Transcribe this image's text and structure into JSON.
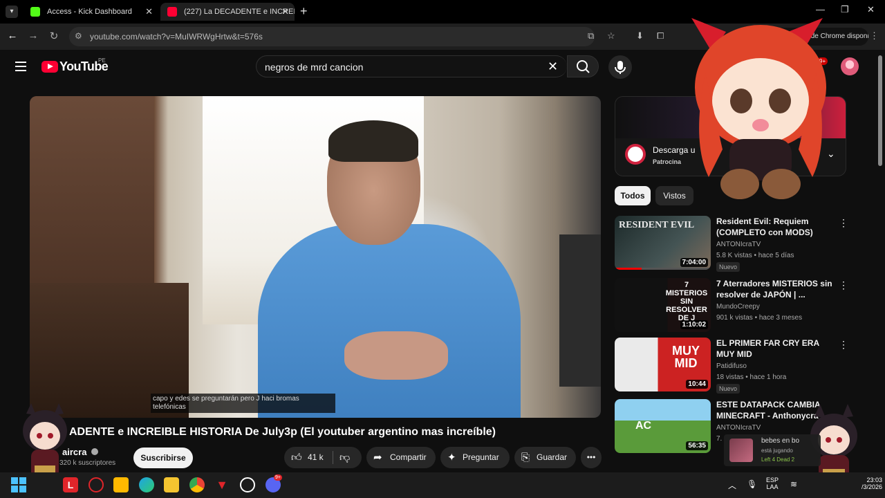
{
  "browser": {
    "tabs": [
      {
        "title": "Access - Kick Dashboard",
        "favicon": "kick-icon",
        "color": "#53fc18",
        "active": false
      },
      {
        "title": "(227) La DECADENTE e INCREIB",
        "favicon": "youtube-icon",
        "color": "#ff0033",
        "active": true
      }
    ],
    "url": "youtube.com/watch?v=MuIWRWgHrtw&t=576s",
    "update_text": "Nueva versión de Chrome disponible"
  },
  "header": {
    "logo_text": "YouTube",
    "country": "PE",
    "search_value": "negros de mrd cancion",
    "notifications": "9+"
  },
  "video": {
    "caption": "capo y edes se preguntarán pero J haci bromas telefónicas",
    "title": "ADENTE e INCREIBLE HISTORIA De July3p (El youtuber argentino mas increíble)",
    "channel": "aircra",
    "subscribers": "320 k suscriptores",
    "subscribe_label": "Suscribirse",
    "likes": "41 k",
    "share_label": "Compartir",
    "ask_label": "Preguntar",
    "save_label": "Guardar"
  },
  "ad": {
    "title": "Descarga u",
    "sponsor": "Patrocina"
  },
  "chips": [
    "Todos",
    "Vistos"
  ],
  "recommendations": [
    {
      "title": "Resident Evil: Requiem (COMPLETO con MODS)",
      "channel": "ANTONIcraTV",
      "meta": "5.8 K vistas • hace 5 días",
      "duration": "7:04:00",
      "badge": "Nuevo",
      "thumb_text": "RESIDENT EVIL"
    },
    {
      "title": "7 Aterradores MISTERIOS sin resolver de JAPÓN | ...",
      "channel": "MundoCreepy",
      "meta": "901 k vistas • hace 3 meses",
      "duration": "1:10:02",
      "badge": "",
      "thumb_text": "7 MISTERIOS SIN RESOLVER DE J"
    },
    {
      "title": "EL PRIMER FAR CRY ERA MUY MID",
      "channel": "Patidifuso",
      "meta": "18 vistas • hace 1 hora",
      "duration": "10:44",
      "badge": "Nuevo",
      "thumb_text": "MUY MID"
    },
    {
      "title": "ESTE DATAPACK CAMBIA MINECRAFT - Anthonycra",
      "channel": "ANTONIcraTV",
      "meta": "7.",
      "duration": "56:35",
      "badge": "",
      "thumb_text": "AC"
    }
  ],
  "overlay_notification": {
    "line1": "bebes en bo",
    "line2": "está jugando",
    "line3": "Left 4 Dead 2"
  },
  "taskbar": {
    "lang_top": "ESP",
    "lang_bottom": "LAA",
    "time": "23:03",
    "date": "/3/2026",
    "discord_badge": "9+"
  }
}
